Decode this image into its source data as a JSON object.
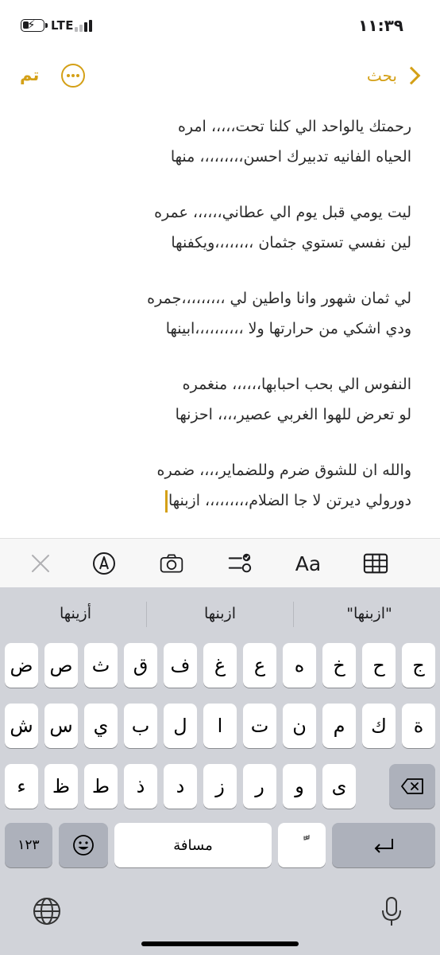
{
  "status": {
    "carrier": "LTE",
    "time": "١١:٣٩"
  },
  "nav": {
    "done_label": "تم",
    "back_label": "بحث"
  },
  "note": {
    "stanzas": [
      [
        "رحمتك يالواحد الي كلنا تحت،،،،، امره",
        "الحياه الفانيه تدبيرك  احسن،،،،،،،،، منها"
      ],
      [
        "ليت يومي قبل يوم الي عطاني،،،،،، عمره",
        "لين نفسي تستوي جثمان ،،،،،،،،ويكفنها"
      ],
      [
        "لي ثمان شهور وانا واطين لي ،،،،،،،،،جمره",
        "ودي اشكي من حرارتها ولا ،،،،،،،،،،ابينها"
      ],
      [
        "النفوس الي بحب احبابها،،،،،، منغمره",
        "لو تعرض للهوا الغربي عصير،،،، احزنها"
      ],
      [
        "والله ان للشوق ضرم وللضماير،،،، ضمره",
        "دورولي ديرتن لا جا الضلام،،،،،،،،، ازبنها"
      ]
    ]
  },
  "toolbar": {
    "icons": [
      "close-icon",
      "markup-icon",
      "camera-icon",
      "checklist-icon",
      "text-format-icon",
      "table-icon"
    ],
    "format_label": "Aa"
  },
  "suggestions": [
    "\"ازبنها\"",
    "ازبنها",
    "أزينها"
  ],
  "keyboard": {
    "row1": [
      "ج",
      "ح",
      "خ",
      "ه",
      "ع",
      "غ",
      "ف",
      "ق",
      "ث",
      "ص",
      "ض"
    ],
    "row2": [
      "ة",
      "ك",
      "م",
      "ن",
      "ت",
      "ا",
      "ل",
      "ب",
      "ي",
      "س",
      "ش"
    ],
    "row3": [
      "ى",
      "و",
      "ر",
      "ز",
      "د",
      "ذ",
      "ط",
      "ظ",
      "ء"
    ],
    "numbers_label": "١٢٣",
    "space_label": "مسافة",
    "diacritic_label": "ًّ",
    "return_label": "↵"
  },
  "colors": {
    "accent": "#d4a017",
    "keyboard_bg": "#d1d3d9",
    "key_bg": "#ffffff",
    "key_dark": "#adb1bb"
  }
}
